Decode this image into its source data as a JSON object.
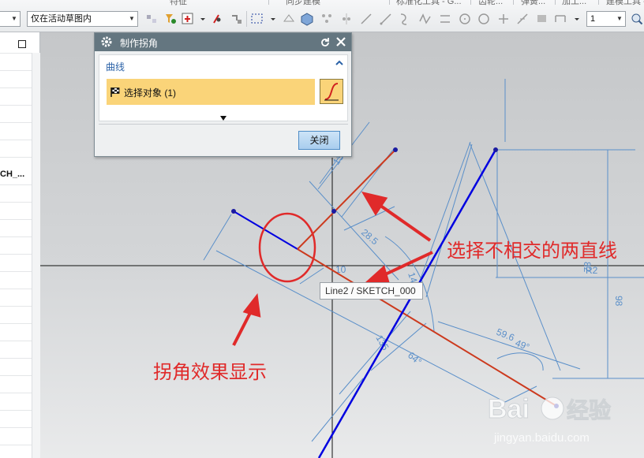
{
  "toolbar": {
    "ribbon_tabs": [
      "特征",
      "同步建模",
      "标准化工具 - G...",
      "齿轮...",
      "弹簧...",
      "加工...",
      "建模工具 - ..."
    ],
    "selection_filter": "",
    "scope_filter": "仅在活动草图内",
    "count_field": "1"
  },
  "dialog": {
    "title": "制作拐角",
    "section_title": "曲线",
    "select_label": "选择对象 (1)",
    "close_button": "关闭"
  },
  "left_panel": {
    "truncated_label": "CH_..."
  },
  "canvas": {
    "tooltip": "Line2 / SKETCH_000",
    "dimensions": [
      "13",
      "28.5",
      "14.8",
      "R2",
      "82",
      "98",
      "59.6",
      "49°",
      "135",
      "64°",
      "10"
    ]
  },
  "annotations": {
    "select_lines": "选择不相交的两直线",
    "corner_effect": "拐角效果显示"
  },
  "watermark": {
    "brand": "Bai",
    "brand2": "经验",
    "url": "jingyan.baidu.com"
  },
  "colors": {
    "dialog_title_bg": "#647680",
    "selection_highlight": "#fad479",
    "sketch_line_blue": "#0000e0",
    "selected_line_red": "#cc3a1e",
    "dimension_blue": "#5a8fc9",
    "annotation_red": "#e02a2a"
  }
}
